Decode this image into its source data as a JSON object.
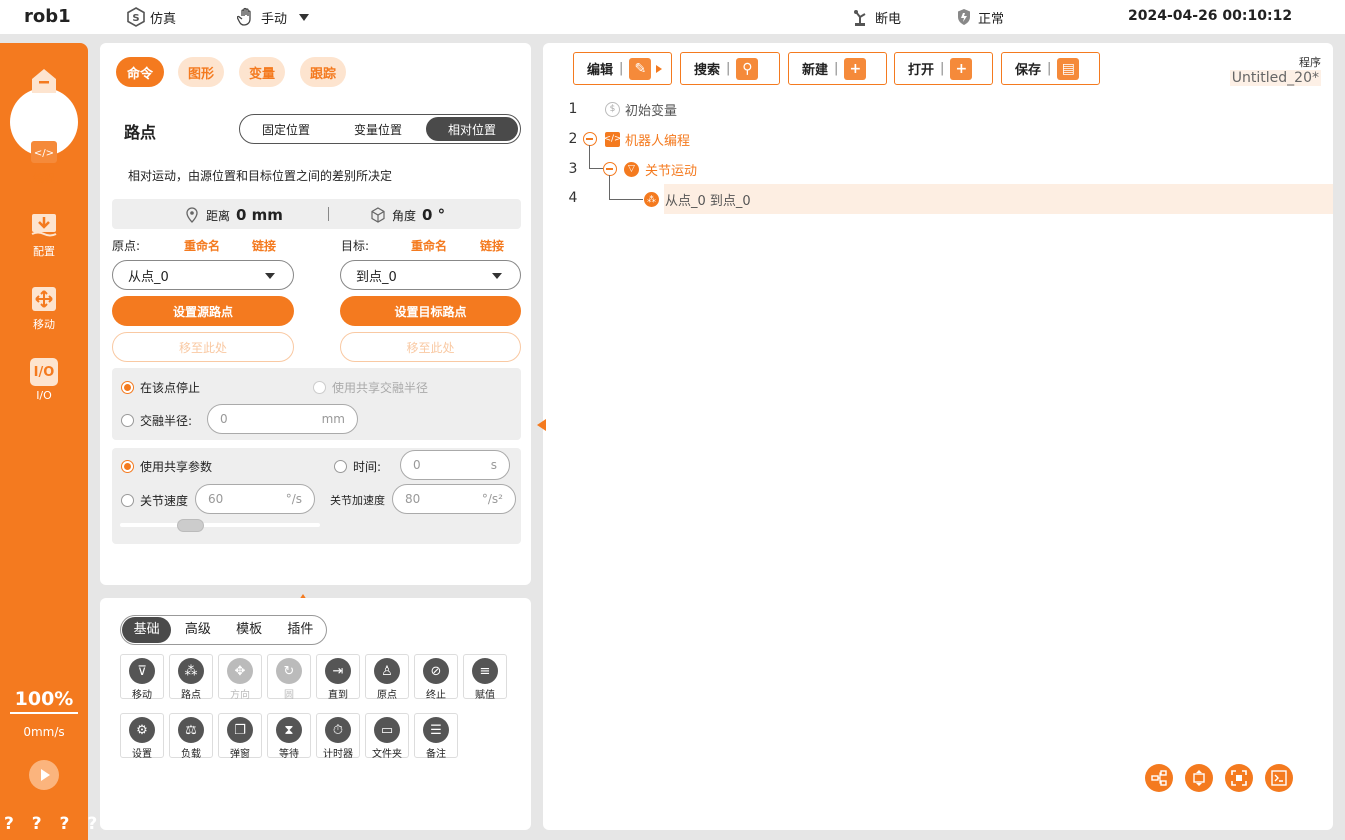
{
  "topbar": {
    "robot": "rob1",
    "sim": "仿真",
    "mode": "手动",
    "power": "断电",
    "status": "正常",
    "datetime": "2024-04-26 00:10:12"
  },
  "sidebar": {
    "items": [
      {
        "label": "主页",
        "icon": "home-icon"
      },
      {
        "label": "编程",
        "icon": "code-icon"
      },
      {
        "label": "配置",
        "icon": "config-icon"
      },
      {
        "label": "移动",
        "icon": "move-icon"
      },
      {
        "label": "I/O",
        "icon": "io-icon"
      }
    ],
    "io_icon_text": "I/O",
    "speed_pct": "100%",
    "speed": "0mm/s",
    "footer": "? ? ? ?"
  },
  "left": {
    "tabs": [
      "命令",
      "图形",
      "变量",
      "跟踪"
    ],
    "title": "路点",
    "seg": [
      "固定位置",
      "变量位置",
      "相对位置"
    ],
    "desc": "相对运动，由源位置和目标位置之间的差别所决定",
    "dist_label": "距离",
    "dist_value": "0 mm",
    "angle_label": "角度",
    "angle_value": "0 °",
    "src_label": "原点:",
    "dst_label": "目标:",
    "rename": "重命名",
    "link": "链接",
    "src_value": "从点_0",
    "dst_value": "到点_0",
    "set_src": "设置源路点",
    "set_dst": "设置目标路点",
    "move_here": "移至此处",
    "stop_here": "在该点停止",
    "shared_blend": "使用共享交融半径",
    "blend_radius": "交融半径:",
    "blend_value": "0",
    "blend_unit": "mm",
    "use_shared": "使用共享参数",
    "time": "时间:",
    "time_value": "0",
    "time_unit": "s",
    "joint_speed": "关节速度",
    "joint_speed_value": "60",
    "joint_speed_unit": "°/s",
    "joint_acc": "关节加速度",
    "joint_acc_value": "80",
    "joint_acc_unit": "°/s²"
  },
  "commands": {
    "tabs": [
      "基础",
      "高级",
      "模板",
      "插件"
    ],
    "row1": [
      {
        "label": "移动",
        "icon": "move-cmd-icon",
        "glyph": "⊽"
      },
      {
        "label": "路点",
        "icon": "waypoint-icon",
        "glyph": "⁂"
      },
      {
        "label": "方向",
        "icon": "direction-icon",
        "glyph": "✥"
      },
      {
        "label": "圆",
        "icon": "circle-icon",
        "glyph": "↻"
      },
      {
        "label": "直到",
        "icon": "until-icon",
        "glyph": "⇥"
      },
      {
        "label": "原点",
        "icon": "origin-icon",
        "glyph": "♙"
      },
      {
        "label": "终止",
        "icon": "halt-icon",
        "glyph": "⊘"
      },
      {
        "label": "赋值",
        "icon": "assign-icon",
        "glyph": "≡"
      }
    ],
    "row2": [
      {
        "label": "设置",
        "icon": "settings-icon",
        "glyph": "⚙"
      },
      {
        "label": "负载",
        "icon": "payload-icon",
        "glyph": "⚖"
      },
      {
        "label": "弹窗",
        "icon": "popup-icon",
        "glyph": "❐"
      },
      {
        "label": "等待",
        "icon": "wait-icon",
        "glyph": "⧗"
      },
      {
        "label": "计时器",
        "icon": "timer-icon",
        "glyph": "⏱"
      },
      {
        "label": "文件夹",
        "icon": "folder-icon",
        "glyph": "▭"
      },
      {
        "label": "备注",
        "icon": "comment-icon",
        "glyph": "☰"
      }
    ]
  },
  "right": {
    "toolbar": [
      "编辑",
      "搜索",
      "新建",
      "打开",
      "保存"
    ],
    "prog_label": "程序",
    "prog_name": "Untitled_20*",
    "lines": [
      {
        "n": "1",
        "text": "初始变量"
      },
      {
        "n": "2",
        "text": "机器人编程"
      },
      {
        "n": "3",
        "text": "关节运动"
      },
      {
        "n": "4",
        "text": "从点_0 到点_0"
      }
    ]
  },
  "colors": {
    "accent": "#f47a1f",
    "accent_light": "#fde4cf"
  }
}
